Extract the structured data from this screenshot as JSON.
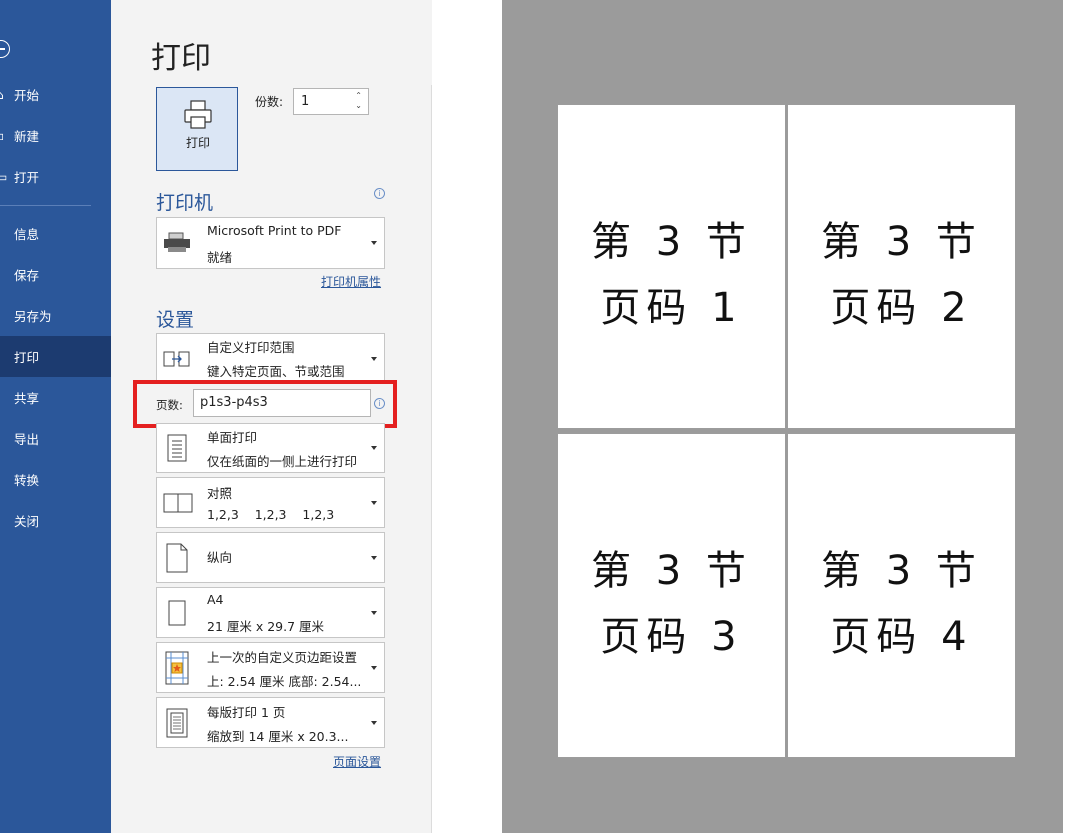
{
  "nav": {
    "items": [
      {
        "label": "开始",
        "icon": "home-icon"
      },
      {
        "label": "新建",
        "icon": "new-doc-icon"
      },
      {
        "label": "打开",
        "icon": "open-folder-icon"
      },
      {
        "label": "信息"
      },
      {
        "label": "保存"
      },
      {
        "label": "另存为"
      },
      {
        "label": "打印",
        "active": true
      },
      {
        "label": "共享"
      },
      {
        "label": "导出"
      },
      {
        "label": "转换"
      },
      {
        "label": "关闭"
      }
    ]
  },
  "panel": {
    "title": "打印",
    "print_button_label": "打印",
    "copies_label": "份数:",
    "copies_value": "1",
    "printer_heading": "打印机",
    "printer_name": "Microsoft Print to PDF",
    "printer_status": "就绪",
    "printer_props_link": "打印机属性",
    "settings_heading": "设置",
    "range_title": "自定义打印范围",
    "range_sub": "键入特定页面、节或范围",
    "pages_label": "页数:",
    "pages_value": "p1s3-p4s3",
    "sides_title": "单面打印",
    "sides_sub": "仅在纸面的一侧上进行打印",
    "collate_title": "对照",
    "collate_sub": "1,2,3    1,2,3    1,2,3",
    "orientation_title": "纵向",
    "paper_title": "A4",
    "paper_sub": "21 厘米 x 29.7 厘米",
    "margins_title": "上一次的自定义页边距设置",
    "margins_sub": "上: 2.54 厘米 底部: 2.54...",
    "perpage_title": "每版打印 1 页",
    "perpage_sub": "缩放到 14 厘米 x 20.3...",
    "page_setup_link": "页面设置"
  },
  "preview": {
    "pages": [
      {
        "line1": "第 3 节",
        "line2": "页码  1"
      },
      {
        "line1": "第 3 节",
        "line2": "页码  2"
      },
      {
        "line1": "第 3 节",
        "line2": "页码  3"
      },
      {
        "line1": "第 3 节",
        "line2": "页码  4"
      }
    ]
  },
  "colors": {
    "nav_bg": "#2b579a",
    "nav_active": "#1c3b70",
    "accent": "#2b579a",
    "highlight": "#e42020",
    "preview_bg": "#9b9b9b"
  }
}
